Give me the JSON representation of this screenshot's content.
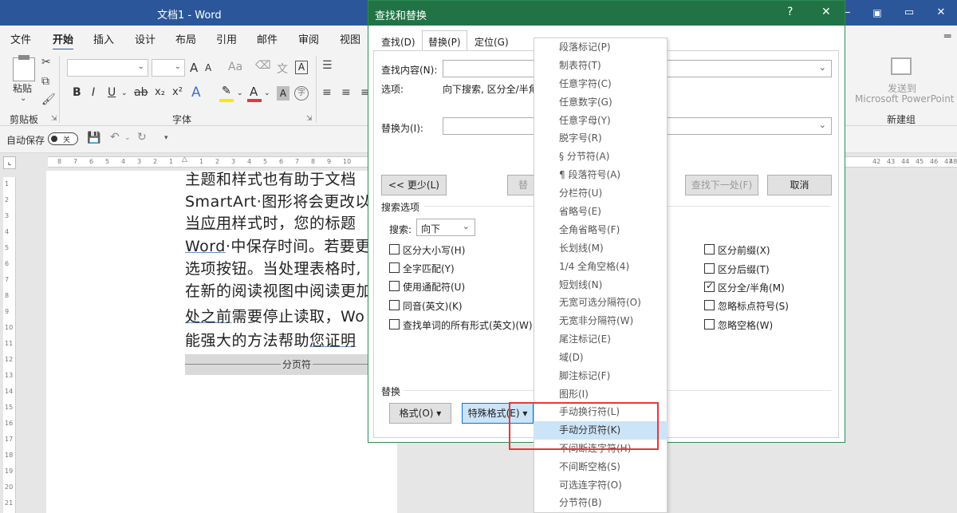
{
  "window": {
    "title": "文档1  -  Word",
    "buttons": [
      "—",
      "▭",
      "✕"
    ]
  },
  "ribbon_tabs": [
    "文件",
    "开始",
    "插入",
    "设计",
    "布局",
    "引用",
    "邮件",
    "审阅",
    "视图"
  ],
  "ribbon": {
    "paste_label": "粘贴",
    "clipboard_label": "剪贴板",
    "font_label": "字体",
    "bold": "B",
    "italic": "I",
    "underline": "U",
    "strike": "ab",
    "sub": "x₂",
    "sup": "x²",
    "grow": "A",
    "shrink": "A",
    "case": "Aa",
    "phonetic": "文",
    "border": "A",
    "effect_a": "A",
    "font_color": "A",
    "shade": "A",
    "enclose": "字",
    "send_label_1": "发送到",
    "send_label_2": "Microsoft PowerPoint",
    "newgroup_label": "新建组"
  },
  "quick_access": {
    "autosave_label": "自动保存",
    "toggle_text": "关"
  },
  "ruler": {
    "left_numbers": [
      "8",
      "7",
      "6",
      "5",
      "4",
      "3",
      "2",
      "1"
    ],
    "right_numbers": [
      "1",
      "2",
      "3",
      "4",
      "5",
      "6",
      "7",
      "8",
      "9",
      "10"
    ],
    "far_right_numbers": [
      "42",
      "43",
      "44",
      "45",
      "46",
      "47",
      "48"
    ],
    "vertical_numbers": [
      "1",
      "2",
      "3",
      "4",
      "5",
      "6",
      "7",
      "8",
      "9",
      "10",
      "11",
      "12",
      "13",
      "14",
      "15",
      "16",
      "17",
      "18",
      "19",
      "20",
      "21"
    ]
  },
  "document": {
    "lines": [
      {
        "pre": "主题和样式也有助于文档",
        "ul": "",
        "post": ""
      },
      {
        "pre": "SmartArt·图形将会更改以",
        "ul": "",
        "post": ""
      },
      {
        "pre": "",
        "ul": "当应用",
        "post": "样式时，您的标题"
      },
      {
        "pre": "",
        "ul": "Word",
        "post": "·中保存时间。若要更"
      },
      {
        "pre": "选项按钮。当处理表格时,",
        "ul": "",
        "post": ""
      },
      {
        "pre": "在新的阅读视图中阅读更加",
        "ul": "",
        "post": ""
      },
      {
        "pre": "",
        "ul": "处之前",
        "post": "需要停止读取，Wo"
      },
      {
        "pre": "能强大的方法帮助",
        "ul": "您证明",
        "post": ""
      }
    ],
    "page_break": "分页符"
  },
  "dialog": {
    "title": "查找和替换",
    "help": "?",
    "close": "✕",
    "tabs": [
      "查找(D)",
      "替换(P)",
      "定位(G)"
    ],
    "find_label": "查找内容(N):",
    "options_label": "选项:",
    "options_value": "向下搜索, 区分全/半角",
    "replace_label": "替换为(I):",
    "less_button": "<< 更少(L)",
    "replace_button": "替",
    "find_next_button": "查找下一处(F)",
    "cancel_button": "取消",
    "search_options_label": "搜索选项",
    "search_label": "搜索:",
    "search_value": "向下",
    "left_checks": [
      {
        "label": "区分大小写(H)",
        "checked": false
      },
      {
        "label": "全字匹配(Y)",
        "checked": false
      },
      {
        "label": "使用通配符(U)",
        "checked": false
      },
      {
        "label": "同音(英文)(K)",
        "checked": false
      },
      {
        "label": "查找单词的所有形式(英文)(W)",
        "checked": false
      }
    ],
    "right_checks": [
      {
        "label": "区分前缀(X)",
        "checked": false
      },
      {
        "label": "区分后缀(T)",
        "checked": false
      },
      {
        "label": "区分全/半角(M)",
        "checked": true
      },
      {
        "label": "忽略标点符号(S)",
        "checked": false
      },
      {
        "label": "忽略空格(W)",
        "checked": false
      }
    ],
    "replace_section_label": "替换",
    "format_button": "格式(O) ▾",
    "special_button": "特殊格式(E) ▾"
  },
  "special_menu": {
    "items": [
      "段落标记(P)",
      "制表符(T)",
      "任意字符(C)",
      "任意数字(G)",
      "任意字母(Y)",
      "脱字号(R)",
      "§ 分节符(A)",
      "¶ 段落符号(A)",
      "分栏符(U)",
      "省略号(E)",
      "全角省略号(F)",
      "长划线(M)",
      "1/4 全角空格(4)",
      "短划线(N)",
      "无宽可选分隔符(O)",
      "无宽非分隔符(W)",
      "尾注标记(E)",
      "域(D)",
      "脚注标记(F)",
      "图形(I)",
      "手动换行符(L)",
      "手动分页符(K)",
      "不间断连字符(H)",
      "不间断空格(S)",
      "可选连字符(O)",
      "分节符(B)"
    ],
    "highlighted_index": 21
  },
  "colors": {
    "word_blue": "#2b579a",
    "dialog_green": "#217346",
    "highlight_red": "#e53935",
    "menu_hover": "#cce4f7"
  }
}
